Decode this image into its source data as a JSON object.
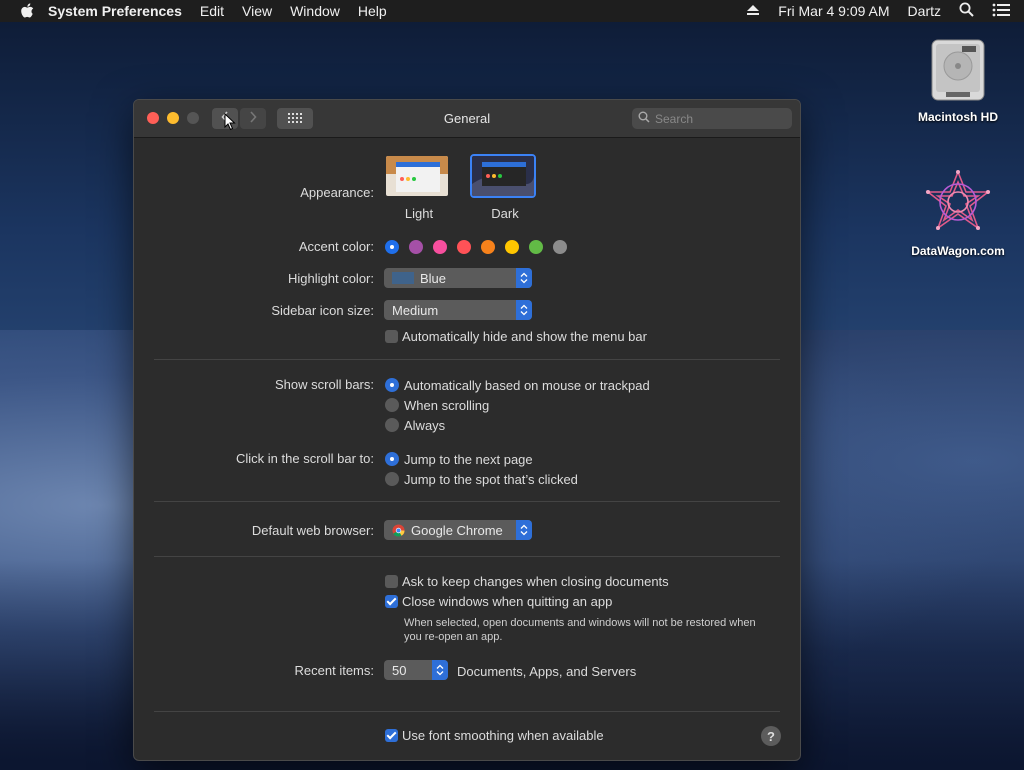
{
  "menubar": {
    "app_name": "System Preferences",
    "items": [
      "Edit",
      "View",
      "Window",
      "Help"
    ],
    "datetime": "Fri Mar 4  9:09 AM",
    "user": "Dartz"
  },
  "desktop": {
    "icons": [
      {
        "label": "Macintosh HD"
      },
      {
        "label": "DataWagon.com"
      }
    ]
  },
  "window": {
    "title": "General",
    "search_placeholder": "Search"
  },
  "appearance": {
    "label": "Appearance:",
    "options": [
      "Light",
      "Dark"
    ],
    "selected": "Dark"
  },
  "accent": {
    "label": "Accent color:",
    "colors": [
      "#1f6feb",
      "#a550a7",
      "#f74f9e",
      "#ff5257",
      "#f7821b",
      "#ffc600",
      "#62ba46",
      "#8c8c8c"
    ],
    "selected_index": 0
  },
  "highlight": {
    "label": "Highlight color:",
    "value": "Blue",
    "swatch": "#3f638b"
  },
  "sidebar_size": {
    "label": "Sidebar icon size:",
    "value": "Medium"
  },
  "menubar_toggle": {
    "label": "Automatically hide and show the menu bar",
    "checked": false
  },
  "scroll_bars": {
    "label": "Show scroll bars:",
    "options": [
      "Automatically based on mouse or trackpad",
      "When scrolling",
      "Always"
    ],
    "selected_index": 0
  },
  "scroll_click": {
    "label": "Click in the scroll bar to:",
    "options": [
      "Jump to the next page",
      "Jump to the spot that’s clicked"
    ],
    "selected_index": 0
  },
  "browser": {
    "label": "Default web browser:",
    "value": "Google Chrome"
  },
  "documents": {
    "ask_keep": "Ask to keep changes when closing documents",
    "close_windows": "Close windows when quitting an app",
    "note": "When selected, open documents and windows will not be restored when you re-open an app."
  },
  "recent": {
    "label": "Recent items:",
    "value": "50",
    "suffix": "Documents, Apps, and Servers"
  },
  "font_smoothing": {
    "label": "Use font smoothing when available"
  },
  "help": {
    "label": "?"
  }
}
